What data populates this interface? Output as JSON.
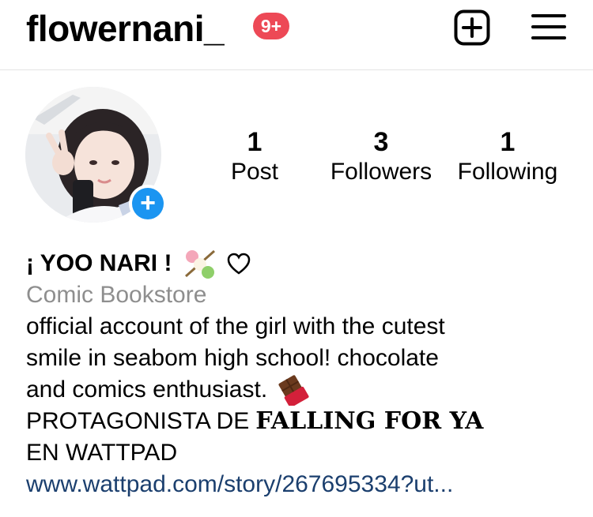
{
  "header": {
    "username": "flowernani_",
    "notification_count": "9+"
  },
  "profile": {
    "stats": {
      "posts": {
        "value": "1",
        "label": "Post"
      },
      "followers": {
        "value": "3",
        "label": "Followers"
      },
      "following": {
        "value": "1",
        "label": "Following"
      }
    },
    "display_name": "¡ YOO NARI !",
    "category": "Comic Bookstore",
    "bio": {
      "line1": "official account of the girl with the cutest",
      "line2": "smile in seabom high school! chocolate",
      "line3": "and comics enthusiast.",
      "line4_prefix": "PROTAGONISTA DE",
      "line4_bold": "FALLING FOR YA",
      "line5": "EN WATTPAD"
    },
    "link": "www.wattpad.com/story/267695334?ut..."
  },
  "colors": {
    "badge": "#ed4956",
    "add_story": "#1b95f1",
    "category": "#8e8e8e",
    "link": "#1b3f6e"
  },
  "icons": [
    "new-post-icon",
    "hamburger-menu-icon",
    "add-story-icon",
    "dango-emoji",
    "heart-icon",
    "chocolate-emoji"
  ]
}
